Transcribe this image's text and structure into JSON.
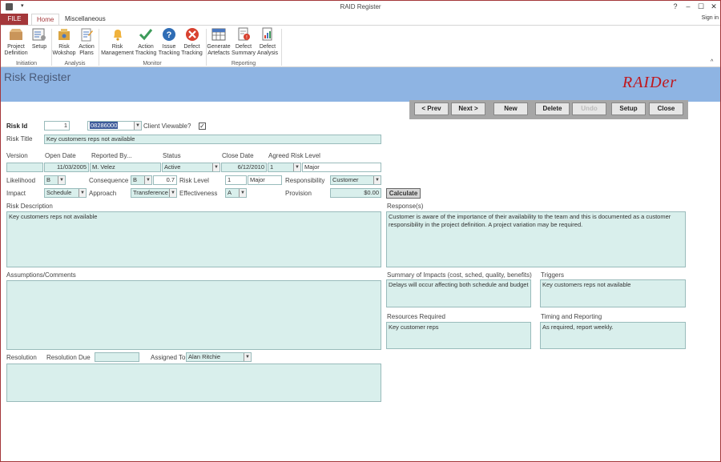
{
  "window": {
    "title": "RAID Register",
    "help": "?",
    "minimize": "–",
    "maximize": "☐",
    "close": "✕",
    "signin": "Sign in"
  },
  "tabs": {
    "file": "FILE",
    "home": "Home",
    "misc": "Miscellaneous"
  },
  "ribbon": {
    "buttons": [
      {
        "label1": "Project",
        "label2": "Definition",
        "icon": "box-icon"
      },
      {
        "label1": "Setup",
        "label2": "",
        "icon": "setup-icon"
      },
      {
        "label1": "Risk",
        "label2": "Wokshop",
        "icon": "workshop-icon"
      },
      {
        "label1": "Action",
        "label2": "Plans",
        "icon": "clipboard-icon"
      },
      {
        "label1": "Risk",
        "label2": "Management",
        "icon": "bell-icon"
      },
      {
        "label1": "Action",
        "label2": "Tracking",
        "icon": "check-icon"
      },
      {
        "label1": "Issue",
        "label2": "Tracking",
        "icon": "question-icon"
      },
      {
        "label1": "Defect",
        "label2": "Tracking",
        "icon": "error-icon"
      },
      {
        "label1": "Generate",
        "label2": "Artefacts",
        "icon": "table-icon"
      },
      {
        "label1": "Defect",
        "label2": "Summary",
        "icon": "warning-doc-icon"
      },
      {
        "label1": "Defect",
        "label2": "Analysis",
        "icon": "chart-doc-icon"
      }
    ],
    "groups": {
      "initiation": "Initiation",
      "analysis": "Analysis",
      "monitor": "Monitor",
      "reporting": "Reporting"
    }
  },
  "header": {
    "title": "Risk Register",
    "logo": "RAIDer"
  },
  "nav": {
    "prev": "< Prev",
    "next": "Next >",
    "new": "New",
    "delete": "Delete",
    "undo": "Undo",
    "setup": "Setup",
    "close": "Close"
  },
  "form": {
    "risk_id_label": "Risk Id",
    "risk_id": "1",
    "client_code": "08286000",
    "client_viewable_label": "Client Viewable?",
    "client_viewable": "✓",
    "risk_title_label": "Risk Title",
    "risk_title": "Key customers reps not available",
    "version_label": "Version",
    "version": "",
    "open_date_label": "Open Date",
    "open_date": "11/03/2005",
    "reported_by_label": "Reported By...",
    "reported_by": "M. Velez",
    "status_label": "Status",
    "status": "Active",
    "close_date_label": "Close Date",
    "close_date": "6/12/2010",
    "agreed_level_label": "Agreed Risk Level",
    "agreed_level": "1",
    "agreed_level_text": "Major",
    "likelihood_label": "Likelihood",
    "likelihood": "B",
    "consequence_label": "Consequence",
    "consequence": "B",
    "consequence_value": "0.7",
    "risk_level_label": "Risk Level",
    "risk_level": "1",
    "risk_level_text": "Major",
    "responsibility_label": "Responsibility",
    "responsibility": "Customer",
    "impact_label": "Impact",
    "impact": "Schedule",
    "approach_label": "Approach",
    "approach": "Transference",
    "effectiveness_label": "Effectiveness",
    "effectiveness": "A",
    "provision_label": "Provision",
    "provision": "$0.00",
    "calculate": "Calculate",
    "risk_description_label": "Risk Description",
    "risk_description": "Key customers reps not available",
    "responses_label": "Response(s)",
    "responses": "Customer is aware of the importance of their availability to the team and this is documented as a customer responsibility in the project definition. A project variation may be required.",
    "assumptions_label": "Assumptions/Comments",
    "assumptions": "",
    "summary_label": "Summary of Impacts (cost, sched, quality, benefits)",
    "summary": "Delays will occur affecting both schedule and budget",
    "triggers_label": "Triggers",
    "triggers": "Key customers reps not available",
    "resources_label": "Resources Required",
    "resources": "Key customer reps",
    "timing_label": "Timing and Reporting",
    "timing": "As required, report weekly.",
    "resolution_label": "Resolution",
    "resolution_due_label": "Resolution Due",
    "resolution_due": "",
    "assigned_to_label": "Assigned To",
    "assigned_to": "Alan Ritchie",
    "resolution": ""
  },
  "colors": {
    "accent": "#a4373a",
    "header": "#8eb4e3",
    "field": "#d9efec",
    "logo": "#c0161c"
  }
}
